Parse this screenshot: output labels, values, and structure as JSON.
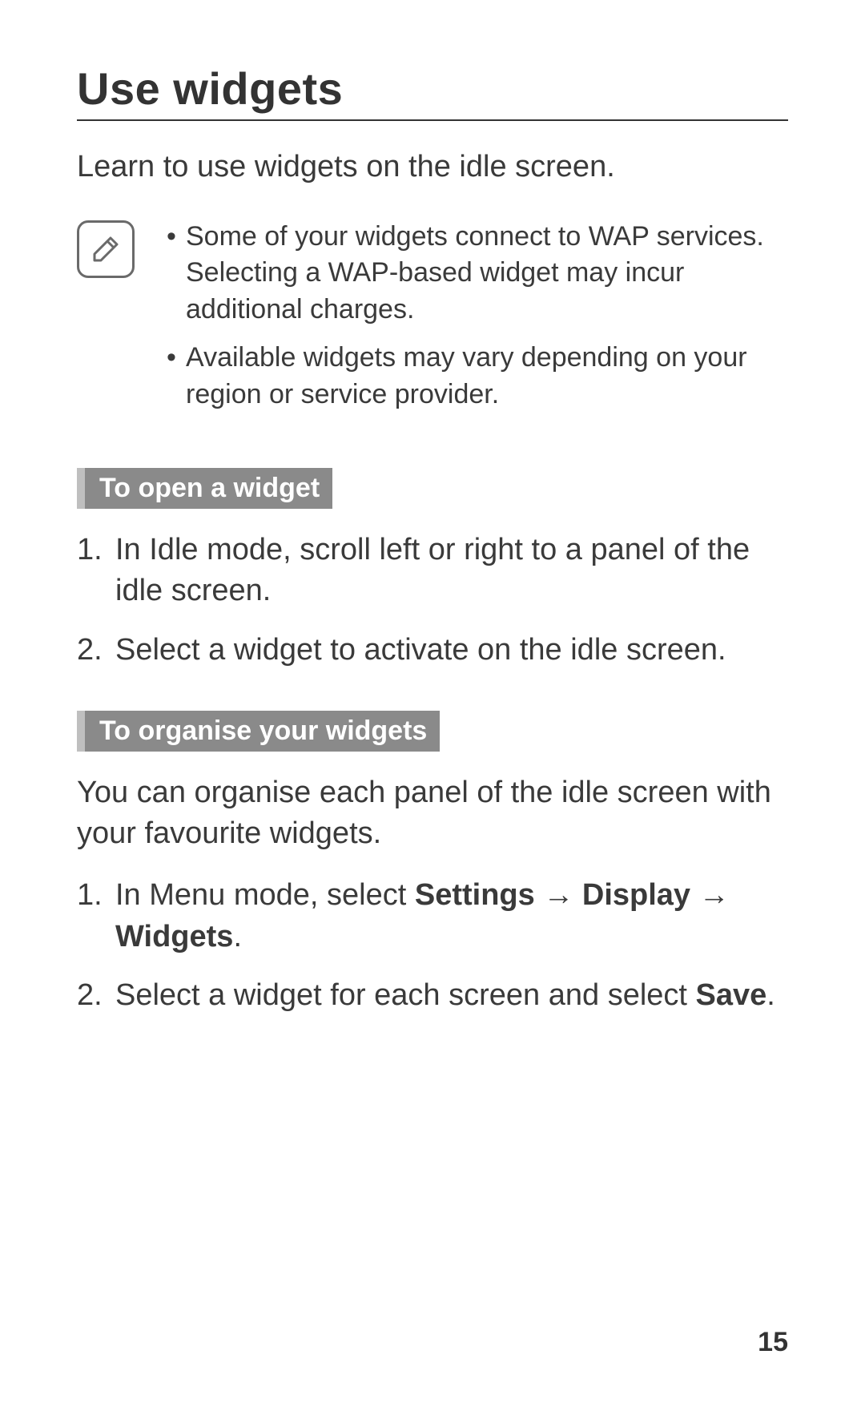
{
  "title": "Use widgets",
  "intro": "Learn to use widgets on the idle screen.",
  "note": {
    "icon_name": "note-icon",
    "items": [
      "Some of your widgets connect to WAP services. Selecting a WAP-based widget may incur additional charges.",
      "Available widgets may vary depending on your region or service provider."
    ]
  },
  "sections": [
    {
      "heading": "To open a widget",
      "body": "",
      "steps": [
        [
          {
            "t": "In Idle mode, scroll left or right to a panel of the idle screen.",
            "b": false
          }
        ],
        [
          {
            "t": "Select a widget to activate on the idle screen.",
            "b": false
          }
        ]
      ]
    },
    {
      "heading": "To organise your widgets",
      "body": "You can organise each panel of the idle screen with your favourite widgets.",
      "steps": [
        [
          {
            "t": "In Menu mode, select ",
            "b": false
          },
          {
            "t": "Settings",
            "b": true
          },
          {
            "t": " → ",
            "b": false
          },
          {
            "t": "Display",
            "b": true
          },
          {
            "t": " → ",
            "b": false
          },
          {
            "t": "Widgets",
            "b": true
          },
          {
            "t": ".",
            "b": false
          }
        ],
        [
          {
            "t": "Select a widget for each screen and select ",
            "b": false
          },
          {
            "t": "Save",
            "b": true
          },
          {
            "t": ".",
            "b": false
          }
        ]
      ]
    }
  ],
  "page_number": "15"
}
